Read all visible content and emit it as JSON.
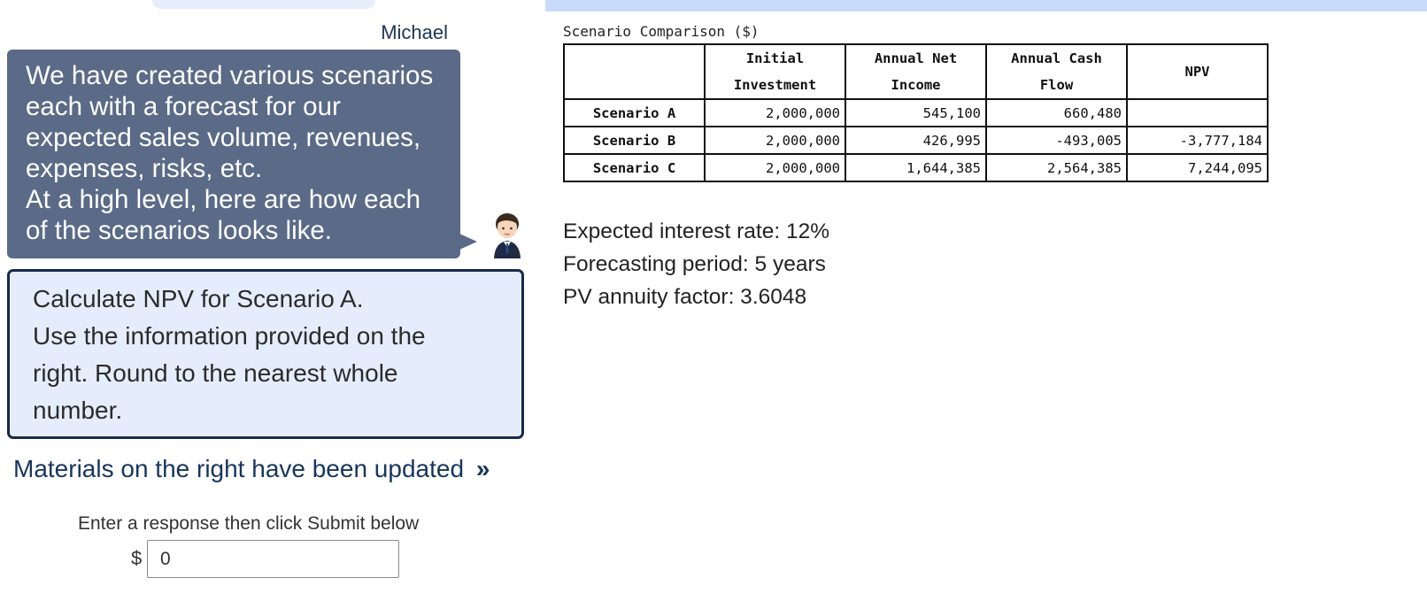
{
  "colors": {
    "speech_bubble_bg": "#5a6a87",
    "question_bg": "#e5edfd",
    "question_border": "#172a4a",
    "accent_text": "#17365d",
    "header_bar": "#c9dbfb"
  },
  "conversation": {
    "speaker_name": "Michael",
    "speech_lines": [
      "We have created various scenarios",
      "each with a forecast for our",
      "expected sales volume, revenues,",
      "expenses, risks, etc.",
      "At a high level, here are how each",
      "of the scenarios looks like."
    ],
    "avatar_icon": "businessman-avatar-icon"
  },
  "question": {
    "lines": [
      "Calculate NPV for Scenario A.",
      "Use the information provided on the",
      "right. Round to the nearest whole",
      "number."
    ]
  },
  "notice": {
    "materials_updated": "Materials on the right have been updated",
    "icon": "double-chevron-right-icon",
    "icon_glyph": "»"
  },
  "response": {
    "instruction": "Enter a response then click Submit below",
    "currency_symbol": "$",
    "value": "0"
  },
  "materials": {
    "table_title": "Scenario Comparison ($)",
    "table": {
      "headers": [
        "",
        "Initial Investment",
        "Annual Net Income",
        "Annual Cash Flow",
        "NPV"
      ],
      "rows": [
        {
          "label": "Scenario A",
          "cells": [
            "2,000,000",
            "545,100",
            "660,480",
            ""
          ]
        },
        {
          "label": "Scenario B",
          "cells": [
            "2,000,000",
            "426,995",
            "-493,005",
            "-3,777,184"
          ]
        },
        {
          "label": "Scenario C",
          "cells": [
            "2,000,000",
            "1,644,385",
            "2,564,385",
            "7,244,095"
          ]
        }
      ]
    },
    "assumptions": [
      "Expected interest rate: 12%",
      "Forecasting period: 5 years",
      "PV annuity factor: 3.6048"
    ]
  }
}
